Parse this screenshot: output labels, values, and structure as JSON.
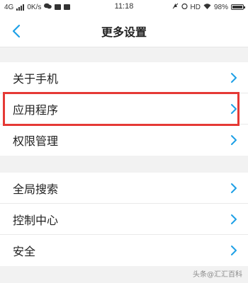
{
  "status_bar": {
    "left_text": "4G",
    "speed": "0K/s",
    "time": "11:18",
    "hd_label": "HD",
    "battery_percent": "98%",
    "battery_level": 0.98
  },
  "nav": {
    "title": "更多设置",
    "back_icon": "chevron-left-icon"
  },
  "groups": [
    {
      "items": [
        {
          "label": "关于手机"
        },
        {
          "label": "应用程序"
        },
        {
          "label": "权限管理"
        }
      ]
    },
    {
      "items": [
        {
          "label": "全局搜索"
        },
        {
          "label": "控制中心"
        },
        {
          "label": "安全"
        }
      ]
    }
  ],
  "highlighted_item": "应用程序",
  "colors": {
    "accent": "#1ea0e6",
    "highlight": "#e53935"
  },
  "watermark": "头条@汇汇百科"
}
